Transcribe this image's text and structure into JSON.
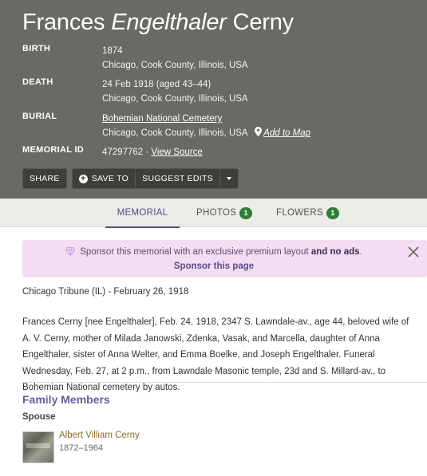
{
  "header": {
    "first_name": "Frances",
    "maiden_name": "Engelthaler",
    "last_name": "Cerny"
  },
  "facts": {
    "birth": {
      "label": "BIRTH",
      "date": "1874",
      "place": "Chicago, Cook County, Illinois, USA"
    },
    "death": {
      "label": "DEATH",
      "date": "24 Feb 1918 (aged 43–44)",
      "place": "Chicago, Cook County, Illinois, USA"
    },
    "burial": {
      "label": "BURIAL",
      "cemetery": "Bohemian National Cemetery",
      "place": "Chicago, Cook County, Illinois, USA",
      "map_link": "Add to Map"
    },
    "memorial_id": {
      "label": "MEMORIAL ID",
      "value": "47297762 ·",
      "source_link": "View Source"
    }
  },
  "actions": {
    "share": "SHARE",
    "save_to": "SAVE TO",
    "suggest_edits": "SUGGEST EDITS"
  },
  "tabs": {
    "memorial": "MEMORIAL",
    "photos": "PHOTOS",
    "photos_count": "1",
    "flowers": "FLOWERS",
    "flowers_count": "1"
  },
  "sponsor": {
    "text": "Sponsor this memorial with an exclusive premium layout",
    "text_and": "and no ads",
    "text_end": ".",
    "link": "Sponsor this page"
  },
  "obituary": {
    "source": "Chicago Tribune (IL) - February 26, 1918",
    "text": "Frances Cerny [nee Engelthaler], Feb. 24, 1918, 2347 S. Lawndale-av., age 44, beloved wife of A. V. Cerny, mother of Milada Janowski, Zdenka, Vasak, and Marcella, daughter of Anna Engelthaler, sister of Anna Welter, and Emma Boelke, and Joseph Engelthaler. Funeral Wednesday, Feb. 27, at 2 p.m., from Lawndale Masonic temple, 23d and S. Millard-av., to Bohemian National cemetery by autos."
  },
  "family": {
    "title": "Family Members",
    "spouse_label": "Spouse",
    "spouse": {
      "name": "Albert Villiam Cerny",
      "dates": "1872–1964"
    }
  },
  "colors": {
    "hero_bg": "#6b6966",
    "accent_purple": "#5a4a8c",
    "badge_green": "#2e7d32",
    "sponsor_bg": "#f4dcf2",
    "link_gold": "#8b6a2e"
  },
  "icons": {
    "pin": "map-pin-icon",
    "plus": "plus-circle-icon",
    "caret": "chevron-down-icon",
    "gem": "diamond-icon",
    "close": "close-icon"
  }
}
